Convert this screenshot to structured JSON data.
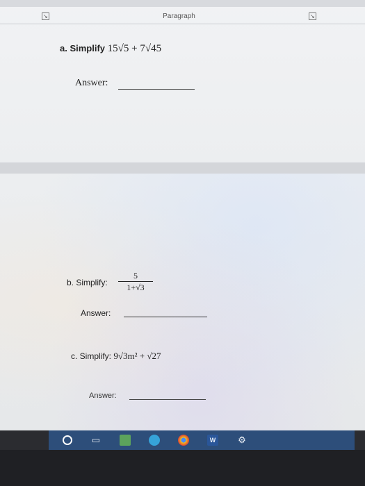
{
  "ribbon": {
    "group_label": "Paragraph"
  },
  "question_a": {
    "label": "a. Simplify",
    "expression": "15√5 + 7√45",
    "answer_label": "Answer:"
  },
  "question_b": {
    "label": "b. Simplify:",
    "numerator": "5",
    "denominator": "1+√3",
    "answer_label": "Answer:"
  },
  "question_c": {
    "label": "c. Simplify:",
    "expression": "9√3m² + √27",
    "answer_label": "Answer:"
  },
  "taskbar": {
    "items": [
      {
        "icon": "cortana-circle-icon"
      },
      {
        "icon": "task-view-icon"
      },
      {
        "icon": "file-explorer-icon"
      },
      {
        "icon": "edge-browser-icon"
      },
      {
        "icon": "chrome-icon"
      },
      {
        "icon": "word-icon",
        "text": "W"
      },
      {
        "icon": "settings-gear-icon"
      }
    ]
  },
  "colors": {
    "taskbar": "#2d4e7a",
    "document_bg": "#eceef0"
  }
}
